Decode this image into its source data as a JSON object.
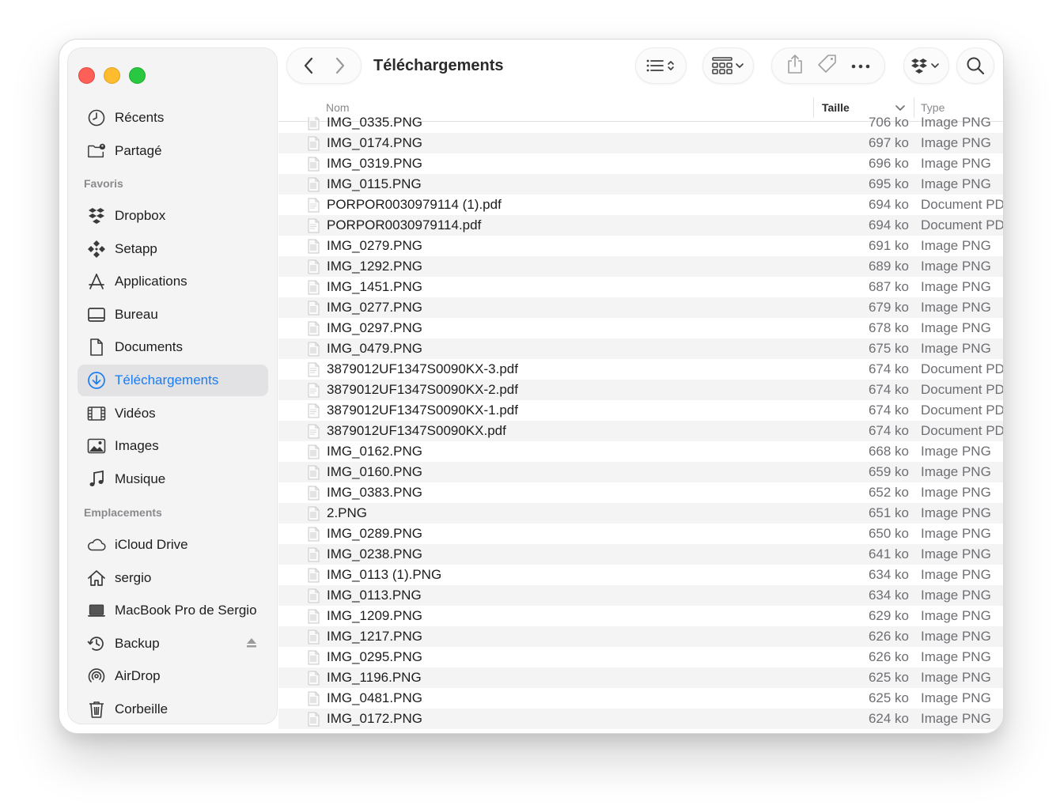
{
  "window": {
    "title": "Téléchargements"
  },
  "sidebar": {
    "top_items": [
      {
        "label": "Récents",
        "icon": "clock-icon"
      },
      {
        "label": "Partagé",
        "icon": "shared-folder-icon"
      }
    ],
    "favorites_heading": "Favoris",
    "favorites": [
      {
        "label": "Dropbox",
        "icon": "dropbox-icon"
      },
      {
        "label": "Setapp",
        "icon": "setapp-icon"
      },
      {
        "label": "Applications",
        "icon": "applications-icon"
      },
      {
        "label": "Bureau",
        "icon": "desktop-icon"
      },
      {
        "label": "Documents",
        "icon": "document-icon"
      },
      {
        "label": "Téléchargements",
        "icon": "download-icon",
        "selected": true
      },
      {
        "label": "Vidéos",
        "icon": "film-icon"
      },
      {
        "label": "Images",
        "icon": "photo-icon"
      },
      {
        "label": "Musique",
        "icon": "music-icon"
      }
    ],
    "locations_heading": "Emplacements",
    "locations": [
      {
        "label": "iCloud Drive",
        "icon": "cloud-icon"
      },
      {
        "label": "sergio",
        "icon": "home-icon"
      },
      {
        "label": "MacBook Pro de Sergio",
        "icon": "laptop-icon"
      },
      {
        "label": "Backup",
        "icon": "time-machine-icon",
        "eject": true
      },
      {
        "label": "AirDrop",
        "icon": "airdrop-icon"
      },
      {
        "label": "Corbeille",
        "icon": "trash-icon"
      }
    ]
  },
  "toolbar": {
    "back_icon": "chevron-left-icon",
    "forward_icon": "chevron-right-icon",
    "view_icon": "list-view-icon",
    "group_icon": "grid-group-icon",
    "share_icon": "share-icon",
    "tag_icon": "tag-icon",
    "more_icon": "ellipsis-icon",
    "dropbox_icon": "dropbox-icon",
    "search_icon": "search-icon"
  },
  "columns": {
    "name": "Nom",
    "size": "Taille",
    "type": "Type"
  },
  "files": [
    {
      "name": "IMG_0335.PNG",
      "size": "706 ko",
      "type": "Image PNG"
    },
    {
      "name": "IMG_0174.PNG",
      "size": "697 ko",
      "type": "Image PNG"
    },
    {
      "name": "IMG_0319.PNG",
      "size": "696 ko",
      "type": "Image PNG"
    },
    {
      "name": "IMG_0115.PNG",
      "size": "695 ko",
      "type": "Image PNG"
    },
    {
      "name": "PORPOR0030979114 (1).pdf",
      "size": "694 ko",
      "type": "Document PDF"
    },
    {
      "name": "PORPOR0030979114.pdf",
      "size": "694 ko",
      "type": "Document PDF"
    },
    {
      "name": "IMG_0279.PNG",
      "size": "691 ko",
      "type": "Image PNG"
    },
    {
      "name": "IMG_1292.PNG",
      "size": "689 ko",
      "type": "Image PNG"
    },
    {
      "name": "IMG_1451.PNG",
      "size": "687 ko",
      "type": "Image PNG"
    },
    {
      "name": "IMG_0277.PNG",
      "size": "679 ko",
      "type": "Image PNG"
    },
    {
      "name": "IMG_0297.PNG",
      "size": "678 ko",
      "type": "Image PNG"
    },
    {
      "name": "IMG_0479.PNG",
      "size": "675 ko",
      "type": "Image PNG"
    },
    {
      "name": "3879012UF1347S0090KX-3.pdf",
      "size": "674 ko",
      "type": "Document PDF"
    },
    {
      "name": "3879012UF1347S0090KX-2.pdf",
      "size": "674 ko",
      "type": "Document PDF"
    },
    {
      "name": "3879012UF1347S0090KX-1.pdf",
      "size": "674 ko",
      "type": "Document PDF"
    },
    {
      "name": "3879012UF1347S0090KX.pdf",
      "size": "674 ko",
      "type": "Document PDF"
    },
    {
      "name": "IMG_0162.PNG",
      "size": "668 ko",
      "type": "Image PNG"
    },
    {
      "name": "IMG_0160.PNG",
      "size": "659 ko",
      "type": "Image PNG"
    },
    {
      "name": "IMG_0383.PNG",
      "size": "652 ko",
      "type": "Image PNG"
    },
    {
      "name": "2.PNG",
      "size": "651 ko",
      "type": "Image PNG"
    },
    {
      "name": "IMG_0289.PNG",
      "size": "650 ko",
      "type": "Image PNG"
    },
    {
      "name": "IMG_0238.PNG",
      "size": "641 ko",
      "type": "Image PNG"
    },
    {
      "name": "IMG_0113 (1).PNG",
      "size": "634 ko",
      "type": "Image PNG"
    },
    {
      "name": "IMG_0113.PNG",
      "size": "634 ko",
      "type": "Image PNG"
    },
    {
      "name": "IMG_1209.PNG",
      "size": "629 ko",
      "type": "Image PNG"
    },
    {
      "name": "IMG_1217.PNG",
      "size": "626 ko",
      "type": "Image PNG"
    },
    {
      "name": "IMG_0295.PNG",
      "size": "626 ko",
      "type": "Image PNG"
    },
    {
      "name": "IMG_1196.PNG",
      "size": "625 ko",
      "type": "Image PNG"
    },
    {
      "name": "IMG_0481.PNG",
      "size": "625 ko",
      "type": "Image PNG"
    },
    {
      "name": "IMG_0172.PNG",
      "size": "624 ko",
      "type": "Image PNG"
    }
  ],
  "colors": {
    "accent": "#1a7cf2",
    "close": "#fe5f57",
    "minimize": "#febc2e",
    "zoom": "#28c840"
  }
}
